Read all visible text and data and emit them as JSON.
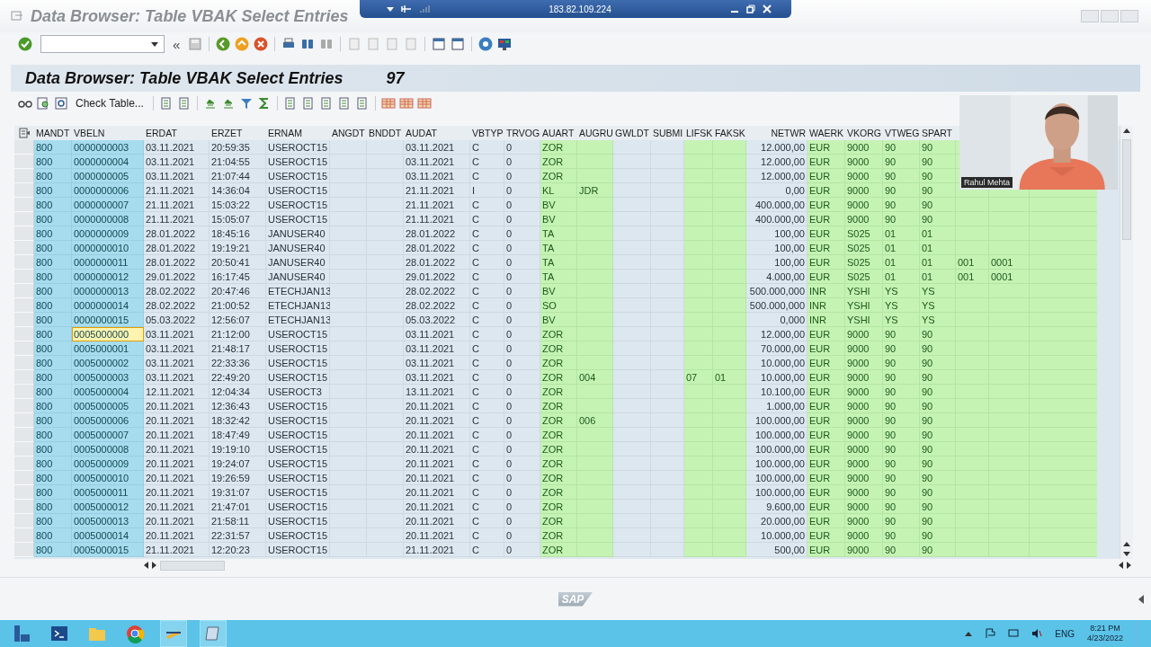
{
  "remote_bar": {
    "address": "183.82.109.224"
  },
  "window": {
    "title": "Data Browser: Table VBAK Select Entries"
  },
  "toolbar": {
    "expand_label": "«"
  },
  "header": {
    "title": "Data Browser: Table VBAK Select Entries",
    "count": "97"
  },
  "app_toolbar": {
    "check_table_button": "Check Table..."
  },
  "table": {
    "columns": [
      {
        "label": "MANDT",
        "kind": "key"
      },
      {
        "label": "VBELN",
        "kind": "key"
      },
      {
        "label": "ERDAT",
        "kind": "plain"
      },
      {
        "label": "ERZET",
        "kind": "plain"
      },
      {
        "label": "ERNAM",
        "kind": "plain"
      },
      {
        "label": "ANGDT",
        "kind": "plain"
      },
      {
        "label": "BNDDT",
        "kind": "plain"
      },
      {
        "label": "AUDAT",
        "kind": "plain"
      },
      {
        "label": "VBTYP",
        "kind": "plain"
      },
      {
        "label": "TRVOG",
        "kind": "plain"
      },
      {
        "label": "AUART",
        "kind": "highlighted"
      },
      {
        "label": "AUGRU",
        "kind": "highlighted"
      },
      {
        "label": "GWLDT",
        "kind": "plain"
      },
      {
        "label": "SUBMI",
        "kind": "plain"
      },
      {
        "label": "LIFSK",
        "kind": "highlighted"
      },
      {
        "label": "FAKSK",
        "kind": "highlighted"
      },
      {
        "label": "NETWR",
        "kind": "amount"
      },
      {
        "label": "WAERK",
        "kind": "highlighted"
      },
      {
        "label": "VKORG",
        "kind": "highlighted"
      },
      {
        "label": "VTWEG",
        "kind": "highlighted"
      },
      {
        "label": "SPART",
        "kind": "highlighted"
      },
      {
        "kind": "highlighted"
      },
      {
        "kind": "highlighted"
      }
    ],
    "rows": [
      {
        "focused": false,
        "cells": [
          "800",
          "0000000003",
          "03.11.2021",
          "20:59:35",
          "USEROCT15",
          null,
          null,
          "03.11.2021",
          "C",
          "0",
          "ZOR",
          null,
          null,
          null,
          null,
          null,
          "12.000,00",
          "EUR",
          "9000",
          "90",
          "90"
        ]
      },
      {
        "focused": false,
        "cells": [
          "800",
          "0000000004",
          "03.11.2021",
          "21:04:55",
          "USEROCT15",
          null,
          null,
          "03.11.2021",
          "C",
          "0",
          "ZOR",
          null,
          null,
          null,
          null,
          null,
          "12.000,00",
          "EUR",
          "9000",
          "90",
          "90"
        ]
      },
      {
        "focused": false,
        "cells": [
          "800",
          "0000000005",
          "03.11.2021",
          "21:07:44",
          "USEROCT15",
          null,
          null,
          "03.11.2021",
          "C",
          "0",
          "ZOR",
          null,
          null,
          null,
          null,
          null,
          "12.000,00",
          "EUR",
          "9000",
          "90",
          "90"
        ]
      },
      {
        "focused": false,
        "cells": [
          "800",
          "0000000006",
          "21.11.2021",
          "14:36:04",
          "USEROCT15",
          null,
          null,
          "21.11.2021",
          "I",
          "0",
          "KL",
          "JDR",
          null,
          null,
          null,
          null,
          "0,00",
          "EUR",
          "9000",
          "90",
          "90"
        ]
      },
      {
        "focused": false,
        "cells": [
          "800",
          "0000000007",
          "21.11.2021",
          "15:03:22",
          "USEROCT15",
          null,
          null,
          "21.11.2021",
          "C",
          "0",
          "BV",
          null,
          null,
          null,
          null,
          null,
          "400.000,00",
          "EUR",
          "9000",
          "90",
          "90"
        ]
      },
      {
        "focused": false,
        "cells": [
          "800",
          "0000000008",
          "21.11.2021",
          "15:05:07",
          "USEROCT15",
          null,
          null,
          "21.11.2021",
          "C",
          "0",
          "BV",
          null,
          null,
          null,
          null,
          null,
          "400.000,00",
          "EUR",
          "9000",
          "90",
          "90"
        ]
      },
      {
        "focused": false,
        "cells": [
          "800",
          "0000000009",
          "28.01.2022",
          "18:45:16",
          "JANUSER40",
          null,
          null,
          "28.01.2022",
          "C",
          "0",
          "TA",
          null,
          null,
          null,
          null,
          null,
          "100,00",
          "EUR",
          "S025",
          "01",
          "01"
        ]
      },
      {
        "focused": false,
        "cells": [
          "800",
          "0000000010",
          "28.01.2022",
          "19:19:21",
          "JANUSER40",
          null,
          null,
          "28.01.2022",
          "C",
          "0",
          "TA",
          null,
          null,
          null,
          null,
          null,
          "100,00",
          "EUR",
          "S025",
          "01",
          "01"
        ]
      },
      {
        "focused": false,
        "cells": [
          "800",
          "0000000011",
          "28.01.2022",
          "20:50:41",
          "JANUSER40",
          null,
          null,
          "28.01.2022",
          "C",
          "0",
          "TA",
          null,
          null,
          null,
          null,
          null,
          "100,00",
          "EUR",
          "S025",
          "01",
          "01",
          "001",
          "0001"
        ]
      },
      {
        "focused": false,
        "cells": [
          "800",
          "0000000012",
          "29.01.2022",
          "16:17:45",
          "JANUSER40",
          null,
          null,
          "29.01.2022",
          "C",
          "0",
          "TA",
          null,
          null,
          null,
          null,
          null,
          "4.000,00",
          "EUR",
          "S025",
          "01",
          "01",
          "001",
          "0001"
        ]
      },
      {
        "focused": false,
        "cells": [
          "800",
          "0000000013",
          "28.02.2022",
          "20:47:46",
          "ETECHJAN13",
          null,
          null,
          "28.02.2022",
          "C",
          "0",
          "BV",
          null,
          null,
          null,
          null,
          null,
          "500.000,000",
          "INR",
          "YSHI",
          "YS",
          "YS"
        ]
      },
      {
        "focused": false,
        "cells": [
          "800",
          "0000000014",
          "28.02.2022",
          "21:00:52",
          "ETECHJAN13",
          null,
          null,
          "28.02.2022",
          "C",
          "0",
          "SO",
          null,
          null,
          null,
          null,
          null,
          "500.000,000",
          "INR",
          "YSHI",
          "YS",
          "YS"
        ]
      },
      {
        "focused": false,
        "cells": [
          "800",
          "0000000015",
          "05.03.2022",
          "12:56:07",
          "ETECHJAN13",
          null,
          null,
          "05.03.2022",
          "C",
          "0",
          "BV",
          null,
          null,
          null,
          null,
          null,
          "0,000",
          "INR",
          "YSHI",
          "YS",
          "YS"
        ]
      },
      {
        "focused": true,
        "cells": [
          "800",
          "0005000000",
          "03.11.2021",
          "21:12:00",
          "USEROCT15",
          null,
          null,
          "03.11.2021",
          "C",
          "0",
          "ZOR",
          null,
          null,
          null,
          null,
          null,
          "12.000,00",
          "EUR",
          "9000",
          "90",
          "90"
        ]
      },
      {
        "focused": false,
        "cells": [
          "800",
          "0005000001",
          "03.11.2021",
          "21:48:17",
          "USEROCT15",
          null,
          null,
          "03.11.2021",
          "C",
          "0",
          "ZOR",
          null,
          null,
          null,
          null,
          null,
          "70.000,00",
          "EUR",
          "9000",
          "90",
          "90"
        ]
      },
      {
        "focused": false,
        "cells": [
          "800",
          "0005000002",
          "03.11.2021",
          "22:33:36",
          "USEROCT15",
          null,
          null,
          "03.11.2021",
          "C",
          "0",
          "ZOR",
          null,
          null,
          null,
          null,
          null,
          "10.000,00",
          "EUR",
          "9000",
          "90",
          "90"
        ]
      },
      {
        "focused": false,
        "cells": [
          "800",
          "0005000003",
          "03.11.2021",
          "22:49:20",
          "USEROCT15",
          null,
          null,
          "03.11.2021",
          "C",
          "0",
          "ZOR",
          "004",
          null,
          null,
          "07",
          "01",
          "10.000,00",
          "EUR",
          "9000",
          "90",
          "90"
        ]
      },
      {
        "focused": false,
        "cells": [
          "800",
          "0005000004",
          "12.11.2021",
          "12:04:34",
          "USEROCT3",
          null,
          null,
          "13.11.2021",
          "C",
          "0",
          "ZOR",
          null,
          null,
          null,
          null,
          null,
          "10.100,00",
          "EUR",
          "9000",
          "90",
          "90"
        ]
      },
      {
        "focused": false,
        "cells": [
          "800",
          "0005000005",
          "20.11.2021",
          "12:36:43",
          "USEROCT15",
          null,
          null,
          "20.11.2021",
          "C",
          "0",
          "ZOR",
          null,
          null,
          null,
          null,
          null,
          "1.000,00",
          "EUR",
          "9000",
          "90",
          "90"
        ]
      },
      {
        "focused": false,
        "cells": [
          "800",
          "0005000006",
          "20.11.2021",
          "18:32:42",
          "USEROCT15",
          null,
          null,
          "20.11.2021",
          "C",
          "0",
          "ZOR",
          "006",
          null,
          null,
          null,
          null,
          "100.000,00",
          "EUR",
          "9000",
          "90",
          "90"
        ]
      },
      {
        "focused": false,
        "cells": [
          "800",
          "0005000007",
          "20.11.2021",
          "18:47:49",
          "USEROCT15",
          null,
          null,
          "20.11.2021",
          "C",
          "0",
          "ZOR",
          null,
          null,
          null,
          null,
          null,
          "100.000,00",
          "EUR",
          "9000",
          "90",
          "90"
        ]
      },
      {
        "focused": false,
        "cells": [
          "800",
          "0005000008",
          "20.11.2021",
          "19:19:10",
          "USEROCT15",
          null,
          null,
          "20.11.2021",
          "C",
          "0",
          "ZOR",
          null,
          null,
          null,
          null,
          null,
          "100.000,00",
          "EUR",
          "9000",
          "90",
          "90"
        ]
      },
      {
        "focused": false,
        "cells": [
          "800",
          "0005000009",
          "20.11.2021",
          "19:24:07",
          "USEROCT15",
          null,
          null,
          "20.11.2021",
          "C",
          "0",
          "ZOR",
          null,
          null,
          null,
          null,
          null,
          "100.000,00",
          "EUR",
          "9000",
          "90",
          "90"
        ]
      },
      {
        "focused": false,
        "cells": [
          "800",
          "0005000010",
          "20.11.2021",
          "19:26:59",
          "USEROCT15",
          null,
          null,
          "20.11.2021",
          "C",
          "0",
          "ZOR",
          null,
          null,
          null,
          null,
          null,
          "100.000,00",
          "EUR",
          "9000",
          "90",
          "90"
        ]
      },
      {
        "focused": false,
        "cells": [
          "800",
          "0005000011",
          "20.11.2021",
          "19:31:07",
          "USEROCT15",
          null,
          null,
          "20.11.2021",
          "C",
          "0",
          "ZOR",
          null,
          null,
          null,
          null,
          null,
          "100.000,00",
          "EUR",
          "9000",
          "90",
          "90"
        ]
      },
      {
        "focused": false,
        "cells": [
          "800",
          "0005000012",
          "20.11.2021",
          "21:47:01",
          "USEROCT15",
          null,
          null,
          "20.11.2021",
          "C",
          "0",
          "ZOR",
          null,
          null,
          null,
          null,
          null,
          "9.600,00",
          "EUR",
          "9000",
          "90",
          "90"
        ]
      },
      {
        "focused": false,
        "cells": [
          "800",
          "0005000013",
          "20.11.2021",
          "21:58:11",
          "USEROCT15",
          null,
          null,
          "20.11.2021",
          "C",
          "0",
          "ZOR",
          null,
          null,
          null,
          null,
          null,
          "20.000,00",
          "EUR",
          "9000",
          "90",
          "90"
        ]
      },
      {
        "focused": false,
        "cells": [
          "800",
          "0005000014",
          "20.11.2021",
          "22:31:57",
          "USEROCT15",
          null,
          null,
          "20.11.2021",
          "C",
          "0",
          "ZOR",
          null,
          null,
          null,
          null,
          null,
          "10.000,00",
          "EUR",
          "9000",
          "90",
          "90"
        ]
      },
      {
        "focused": false,
        "cells": [
          "800",
          "0005000015",
          "21.11.2021",
          "12:20:23",
          "USEROCT15",
          null,
          null,
          "21.11.2021",
          "C",
          "0",
          "ZOR",
          null,
          null,
          null,
          null,
          null,
          "500,00",
          "EUR",
          "9000",
          "90",
          "90"
        ]
      }
    ]
  },
  "video_overlay": {
    "name_label": "Rahul Mehta"
  },
  "status_bar": {
    "logo": "SAP"
  },
  "taskbar": {
    "language": "ENG",
    "time": "8:21 PM",
    "date": "4/23/2022"
  }
}
